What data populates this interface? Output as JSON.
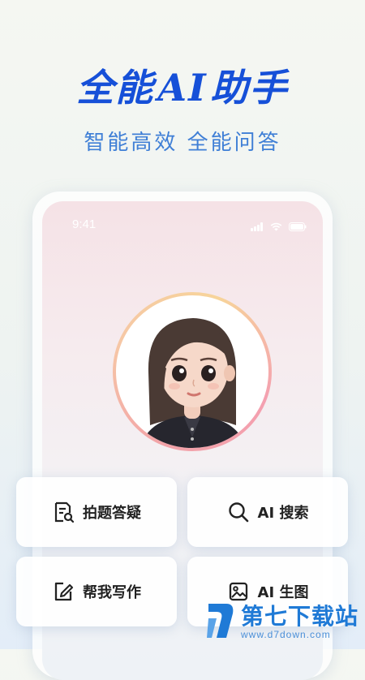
{
  "hero": {
    "title_prefix": "全能",
    "title_ai": "AI",
    "title_suffix": "助手",
    "subtitle": "智能高效 全能问答"
  },
  "phone": {
    "status_time": "9:41",
    "status_icons": [
      "signal-icon",
      "wifi-icon",
      "battery-icon"
    ],
    "avatar": "assistant-avatar"
  },
  "features": [
    {
      "label": "拍题答疑",
      "icon": "doc-search-icon"
    },
    {
      "label": "AI 搜索",
      "icon": "search-icon"
    },
    {
      "label": "帮我写作",
      "icon": "edit-icon"
    },
    {
      "label": "AI 生图",
      "icon": "image-icon"
    }
  ],
  "watermark": {
    "title": "第七下载站",
    "url": "www.d7down.com"
  },
  "colors": {
    "brand_blue": "#1650d8",
    "subtitle_blue": "#3f7fd6",
    "watermark_blue": "#1f7ad6"
  }
}
